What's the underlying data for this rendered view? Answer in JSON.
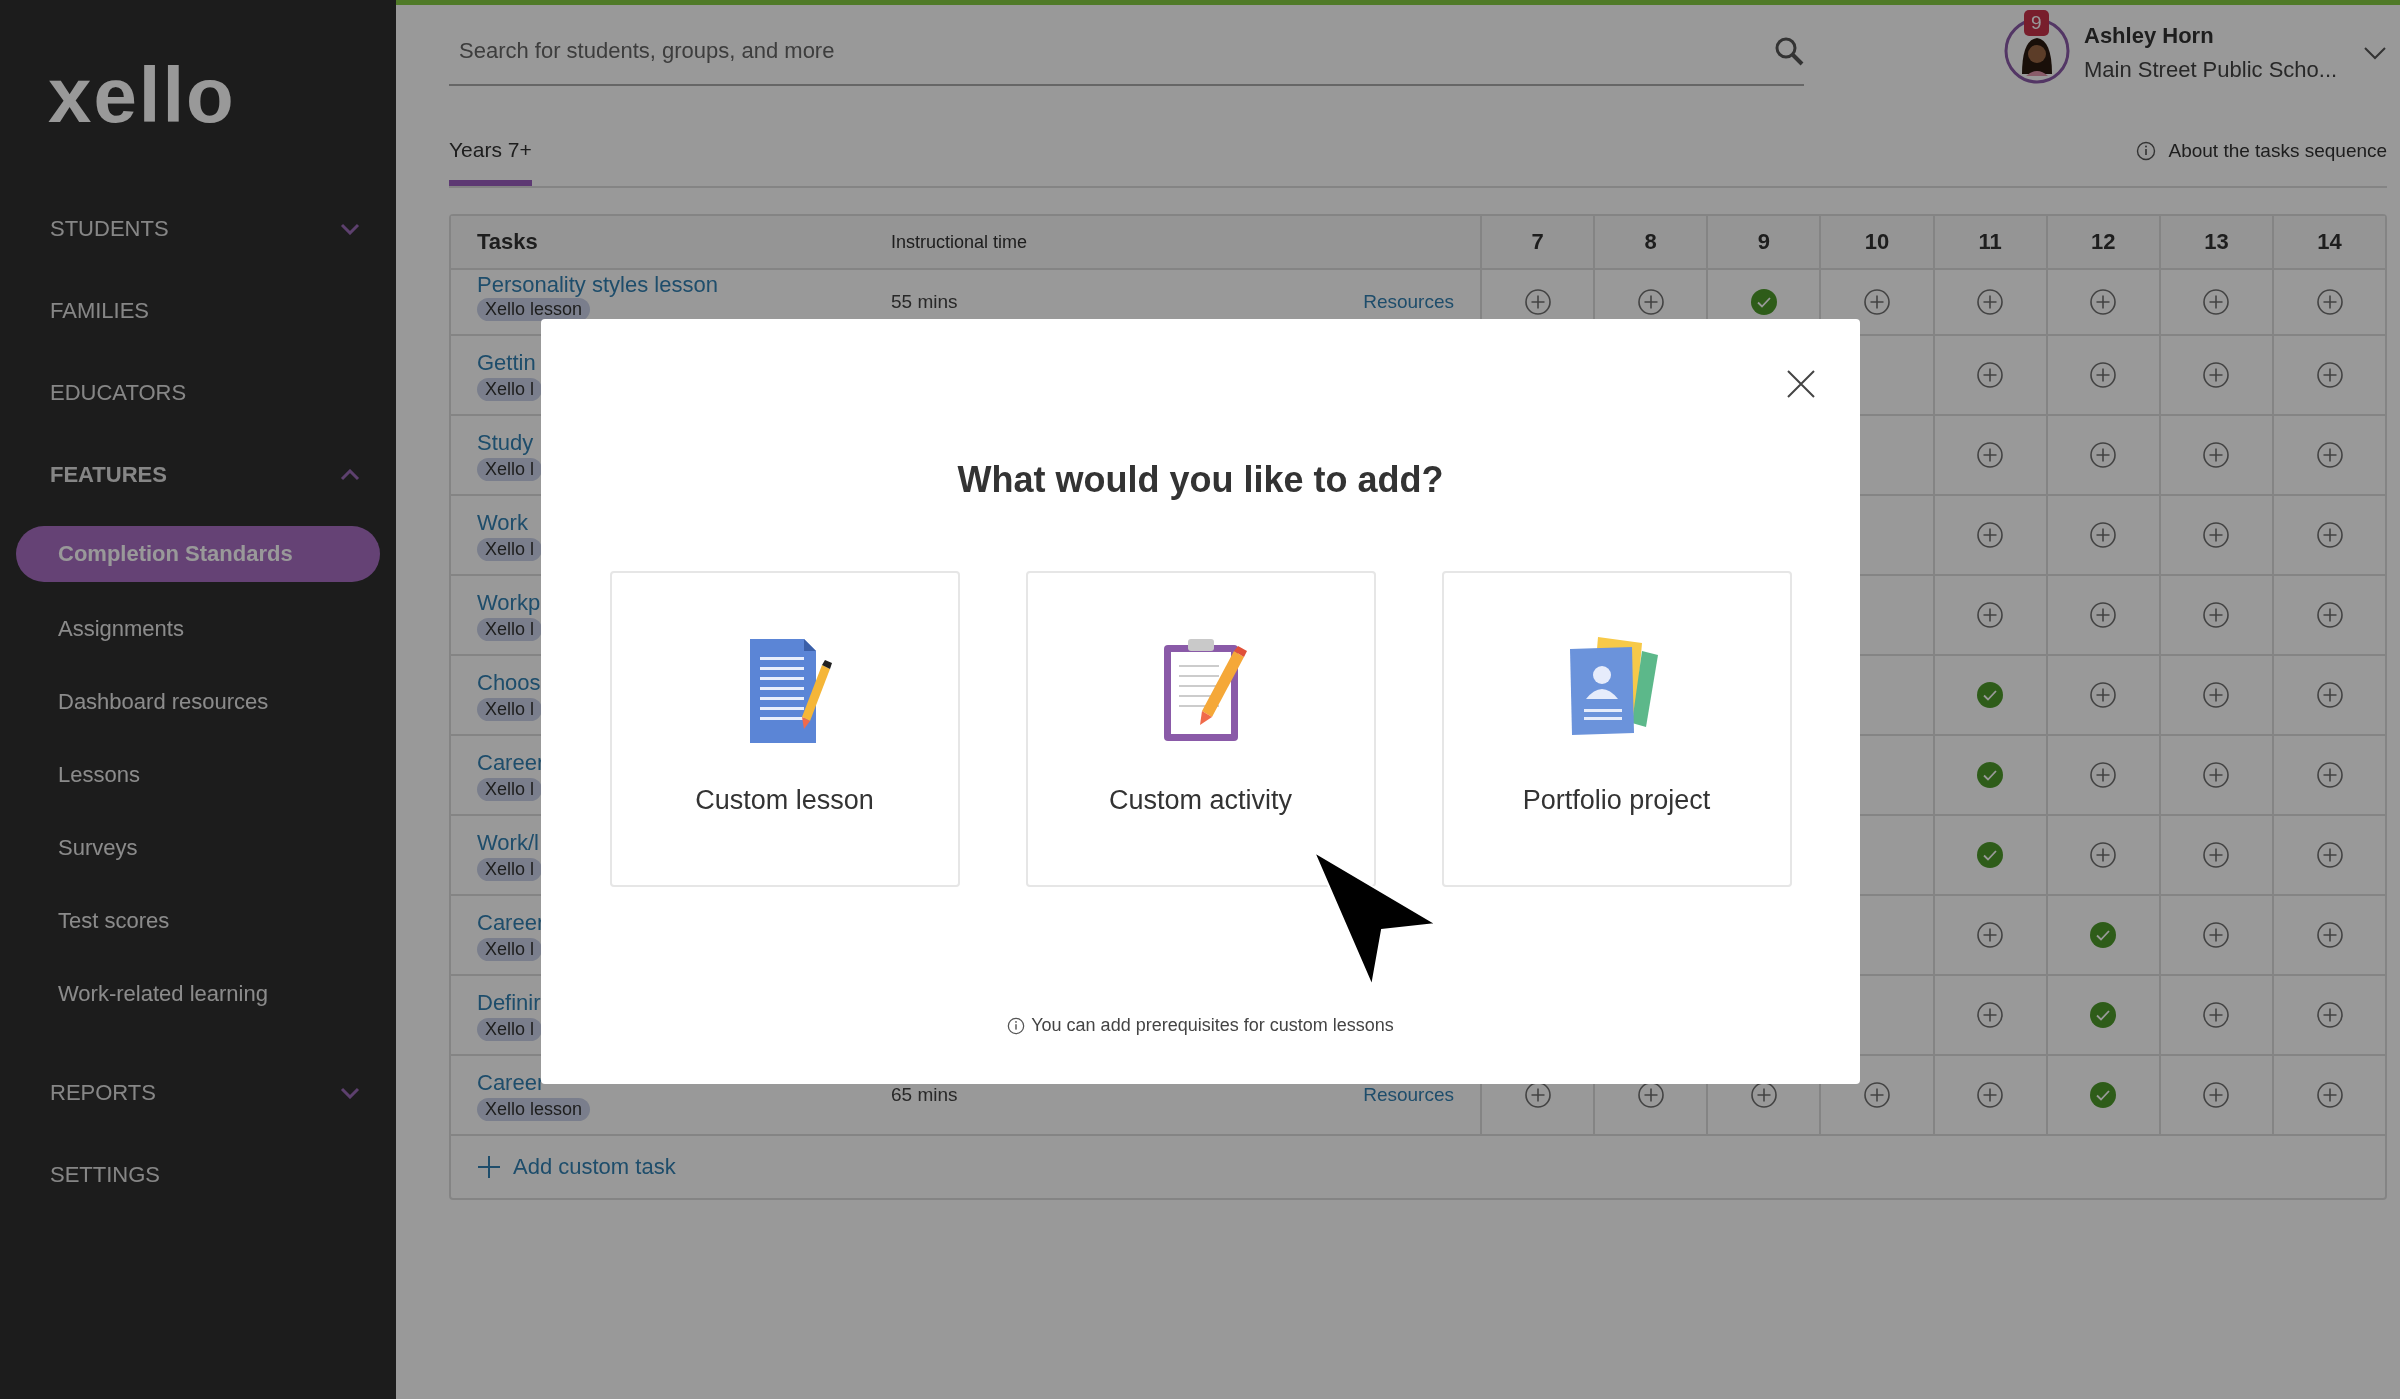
{
  "logo": "xello",
  "sidebar": {
    "items": [
      {
        "label": "STUDENTS",
        "expanded": false
      },
      {
        "label": "FAMILIES"
      },
      {
        "label": "EDUCATORS"
      },
      {
        "label": "FEATURES",
        "expanded": true,
        "children": [
          {
            "label": "Completion Standards",
            "selected": true
          },
          {
            "label": "Assignments",
            "selected": false
          },
          {
            "label": "Dashboard resources",
            "selected": false
          },
          {
            "label": "Lessons",
            "selected": false
          },
          {
            "label": "Surveys",
            "selected": false
          },
          {
            "label": "Test scores",
            "selected": false
          },
          {
            "label": "Work-related learning",
            "selected": false
          }
        ]
      },
      {
        "label": "REPORTS",
        "expanded": false
      },
      {
        "label": "SETTINGS"
      }
    ]
  },
  "search": {
    "placeholder": "Search for students, groups, and more"
  },
  "user": {
    "name": "Ashley Horn",
    "school": "Main Street Public Scho...",
    "badge": "9"
  },
  "tabs": [
    {
      "label": "Years 7+",
      "selected": true
    }
  ],
  "about_link": "About the tasks sequence",
  "table": {
    "columns": [
      "Tasks",
      "Instructional time",
      "7",
      "8",
      "9",
      "10",
      "11",
      "12",
      "13",
      "14"
    ],
    "rows": [
      {
        "title": "Personality styles lesson",
        "tag": "Xello lesson",
        "time": "55 mins",
        "resources": "Resources",
        "cells": [
          {
            "done": false
          },
          {
            "done": false
          },
          {
            "done": true
          },
          {
            "done": false
          },
          {
            "done": false
          },
          {
            "done": false
          },
          {
            "done": false
          },
          {
            "done": false
          }
        ]
      },
      {
        "title": "Gettin",
        "tag": "Xello l",
        "cells": [
          {
            "done": false
          },
          {
            "done": false
          },
          {
            "done": false
          },
          {
            "done": false
          }
        ]
      },
      {
        "title": "Study",
        "tag": "Xello l",
        "cells": [
          {
            "done": false
          },
          {
            "done": false
          },
          {
            "done": false
          },
          {
            "done": false
          }
        ]
      },
      {
        "title": "Work",
        "tag": "Xello l",
        "cells": [
          {
            "done": false
          },
          {
            "done": false
          },
          {
            "done": false
          },
          {
            "done": false
          }
        ]
      },
      {
        "title": "Workp",
        "tag": "Xello l",
        "cells": [
          {
            "done": false
          },
          {
            "done": false
          },
          {
            "done": false
          },
          {
            "done": false
          }
        ]
      },
      {
        "title": "Choos",
        "tag": "Xello l",
        "cells": [
          {
            "done": true
          },
          {
            "done": false
          },
          {
            "done": false
          },
          {
            "done": false
          }
        ]
      },
      {
        "title": "Career",
        "tag": "Xello l",
        "cells": [
          {
            "done": true
          },
          {
            "done": false
          },
          {
            "done": false
          },
          {
            "done": false
          }
        ]
      },
      {
        "title": "Work/l",
        "tag": "Xello l",
        "cells": [
          {
            "done": true
          },
          {
            "done": false
          },
          {
            "done": false
          },
          {
            "done": false
          }
        ]
      },
      {
        "title": "Career",
        "tag": "Xello l",
        "cells": [
          {
            "done": false
          },
          {
            "done": true
          },
          {
            "done": false
          },
          {
            "done": false
          }
        ]
      },
      {
        "title": "Definir",
        "tag": "Xello l",
        "cells": [
          {
            "done": false
          },
          {
            "done": true
          },
          {
            "done": false
          },
          {
            "done": false
          }
        ]
      },
      {
        "title": "Career",
        "tag": "Xello lesson",
        "time": "65 mins",
        "resources": "Resources",
        "cells": [
          {
            "done": false
          },
          {
            "done": false
          },
          {
            "done": false
          },
          {
            "done": false
          },
          {
            "done": false
          },
          {
            "done": true
          },
          {
            "done": false
          },
          {
            "done": false
          }
        ]
      }
    ],
    "add_task": "Add custom task"
  },
  "modal": {
    "title": "What would you like to add?",
    "options": [
      {
        "kind": "lesson",
        "label": "Custom lesson"
      },
      {
        "kind": "activity",
        "label": "Custom activity"
      },
      {
        "kind": "portfolio",
        "label": "Portfolio project"
      }
    ],
    "note": "You can add prerequisites for custom lessons"
  }
}
